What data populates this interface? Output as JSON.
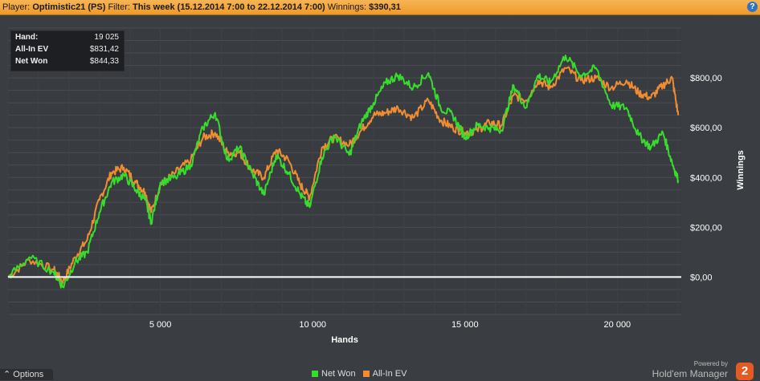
{
  "header": {
    "player_label": "Player:",
    "player_value": "Optimistic21 (PS)",
    "filter_label": "Filter:",
    "filter_value": "This week (15.12.2014 7:00 to 22.12.2014 7:00)",
    "winnings_label": "Winnings:",
    "winnings_value": "$390,31",
    "help_icon": "question-icon",
    "help_text": "?"
  },
  "stats": {
    "hand_label": "Hand:",
    "hand_value": "19 025",
    "ev_label": "All-In EV",
    "ev_value": "$831,42",
    "net_label": "Net Won",
    "net_value": "$844,33"
  },
  "footer": {
    "options_label": "Options",
    "options_icon": "chevron-up-icon",
    "powered_by": "Powered by",
    "brand_name": "Hold'em Manager",
    "brand_logo": "2"
  },
  "colors": {
    "net_won": "#38dc2c",
    "all_in_ev": "#f08c32",
    "zero_line": "#ffffff",
    "grid": "#4a4d52"
  },
  "chart_data": {
    "type": "line",
    "xlabel": "Hands",
    "ylabel": "Winnings",
    "xlim": [
      0,
      22100
    ],
    "ylim": [
      -150,
      1000
    ],
    "x_ticks": [
      5000,
      10000,
      15000,
      20000
    ],
    "x_tick_labels": [
      "5 000",
      "10 000",
      "15 000",
      "20 000"
    ],
    "y_ticks": [
      0,
      200,
      400,
      600,
      800
    ],
    "y_tick_labels": [
      "$0,00",
      "$200,00",
      "$400,00",
      "$600,00",
      "$800,00"
    ],
    "grid": true,
    "legend_position": "bottom",
    "series": [
      {
        "name": "Net Won",
        "x": [
          0,
          700,
          1500,
          1800,
          2200,
          2600,
          3000,
          3400,
          3800,
          4200,
          4500,
          4700,
          5000,
          5500,
          6000,
          6400,
          6800,
          7200,
          7600,
          8000,
          8400,
          8800,
          9200,
          9600,
          9900,
          10300,
          10700,
          11200,
          11600,
          12000,
          12400,
          12800,
          13300,
          13800,
          14200,
          14600,
          15000,
          15400,
          15800,
          16200,
          16600,
          17000,
          17400,
          17800,
          18300,
          18800,
          19300,
          19800,
          20300,
          20700,
          21100,
          21500,
          21800,
          22000
        ],
        "values": [
          0,
          80,
          20,
          -40,
          60,
          100,
          260,
          380,
          410,
          350,
          310,
          220,
          380,
          400,
          450,
          600,
          660,
          470,
          520,
          420,
          330,
          490,
          420,
          330,
          280,
          480,
          570,
          490,
          620,
          700,
          780,
          810,
          760,
          820,
          680,
          650,
          560,
          610,
          600,
          590,
          770,
          680,
          810,
          780,
          890,
          810,
          840,
          690,
          680,
          570,
          520,
          580,
          460,
          390
        ]
      },
      {
        "name": "All-In EV",
        "x": [
          0,
          700,
          1500,
          1800,
          2200,
          2600,
          3000,
          3400,
          3800,
          4200,
          4500,
          4700,
          5000,
          5500,
          6000,
          6400,
          6800,
          7200,
          7600,
          8000,
          8400,
          8800,
          9200,
          9600,
          9900,
          10300,
          10700,
          11200,
          11600,
          12000,
          12400,
          12800,
          13300,
          13800,
          14200,
          14600,
          15000,
          15400,
          15800,
          16200,
          16600,
          17000,
          17400,
          17800,
          18300,
          18800,
          19300,
          19800,
          20300,
          20700,
          21100,
          21500,
          21800,
          22000
        ],
        "values": [
          0,
          70,
          30,
          -20,
          80,
          150,
          310,
          420,
          440,
          380,
          340,
          260,
          370,
          420,
          470,
          560,
          580,
          500,
          500,
          430,
          400,
          510,
          470,
          370,
          320,
          520,
          560,
          530,
          590,
          650,
          660,
          680,
          640,
          710,
          630,
          600,
          580,
          590,
          620,
          610,
          730,
          710,
          790,
          760,
          840,
          790,
          800,
          760,
          790,
          740,
          720,
          770,
          800,
          650
        ]
      }
    ]
  }
}
